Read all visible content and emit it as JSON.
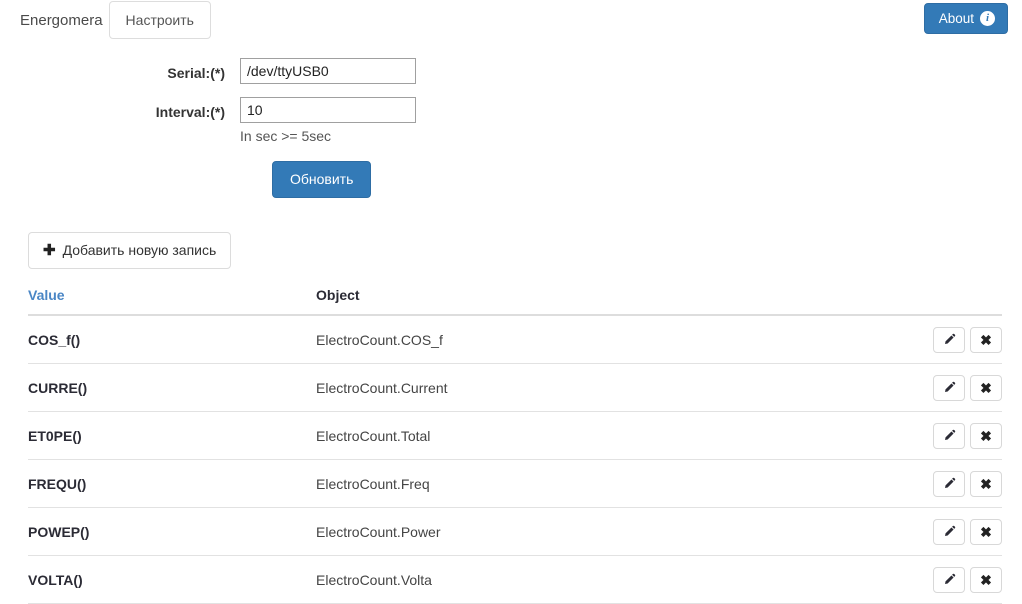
{
  "header": {
    "brand": "Energomera",
    "tabs": [
      {
        "label": "Настроить",
        "active": true
      }
    ],
    "about": {
      "label": "About",
      "icon": "info-circle-icon"
    },
    "accent_color": "#337ab7"
  },
  "form": {
    "fields": [
      {
        "label": "Serial:(*)",
        "value": "/dev/ttyUSB0",
        "placeholder": "",
        "help": ""
      },
      {
        "label": "Interval:(*)",
        "value": "10",
        "placeholder": "",
        "help": "In sec >= 5sec"
      }
    ],
    "submit_label": "Обновить"
  },
  "toolbar": {
    "add_label": "Добавить новую запись",
    "add_icon": "plus-icon"
  },
  "table": {
    "columns": {
      "value": "Value",
      "object": "Object"
    },
    "value_header_color": "#4a86c5",
    "rows": [
      {
        "value": "COS_f()",
        "object": "ElectroCount.COS_f"
      },
      {
        "value": "CURRE()",
        "object": "ElectroCount.Current"
      },
      {
        "value": "ET0PE()",
        "object": "ElectroCount.Total"
      },
      {
        "value": "FREQU()",
        "object": "ElectroCount.Freq"
      },
      {
        "value": "POWEP()",
        "object": "ElectroCount.Power"
      },
      {
        "value": "VOLTA()",
        "object": "ElectroCount.Volta"
      }
    ],
    "row_actions": {
      "edit_icon": "pencil-icon",
      "delete_icon": "close-x-icon",
      "delete_glyph": "✖"
    }
  }
}
